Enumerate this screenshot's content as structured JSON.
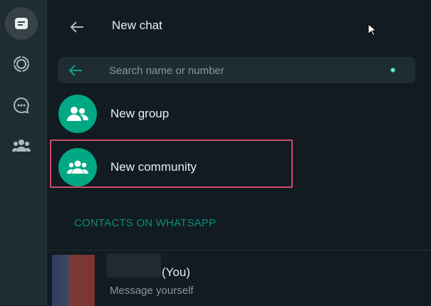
{
  "nav": {
    "items": [
      {
        "icon": "chats-icon",
        "active": true
      },
      {
        "icon": "status-icon",
        "active": false
      },
      {
        "icon": "channels-icon",
        "active": false
      },
      {
        "icon": "communities-icon",
        "active": false
      }
    ]
  },
  "header": {
    "title": "New chat"
  },
  "search": {
    "placeholder": "Search name or number",
    "value": ""
  },
  "actions": [
    {
      "label": "New group",
      "icon": "group-icon"
    },
    {
      "label": "New community",
      "icon": "community-icon",
      "highlighted": true
    }
  ],
  "section": {
    "title": "CONTACTS ON WHATSAPP"
  },
  "contact": {
    "name_suffix": "(You)",
    "subtitle": "Message yourself"
  },
  "colors": {
    "accent": "#00a884",
    "background": "#111b21",
    "rail": "#202c33",
    "highlight": "#d34b6c"
  }
}
